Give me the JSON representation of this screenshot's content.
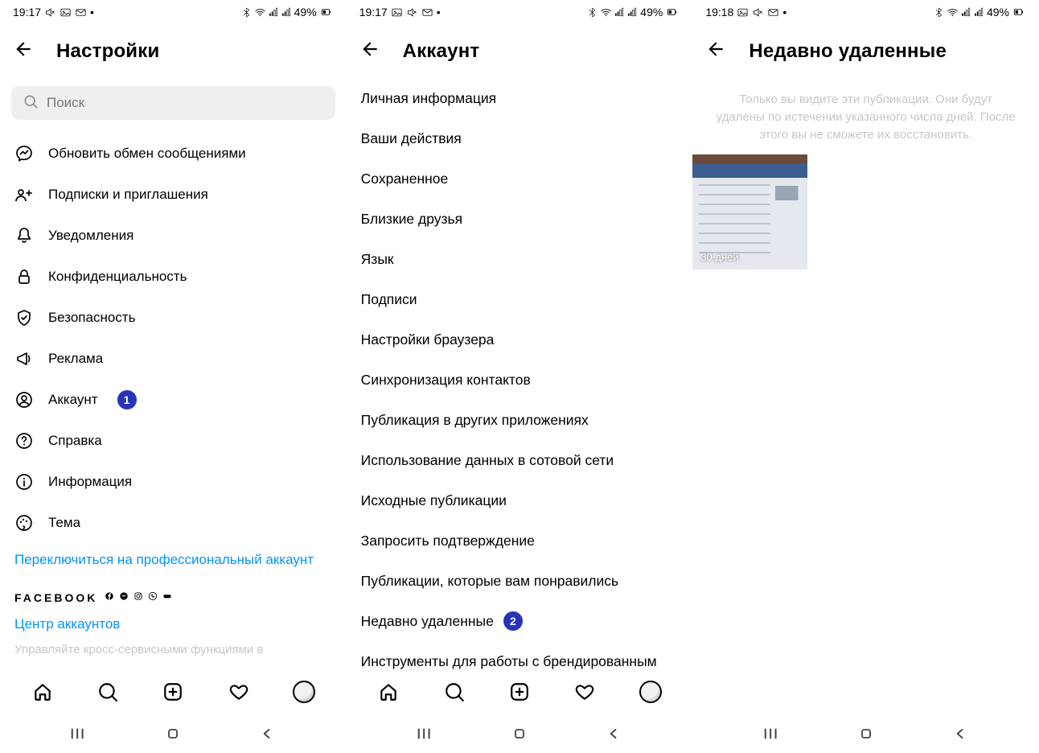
{
  "status": {
    "time1": "19:17",
    "time2": "19:17",
    "time3": "19:18",
    "battery": "49%"
  },
  "screen1": {
    "title": "Настройки",
    "search_placeholder": "Поиск",
    "items": [
      {
        "icon": "messenger",
        "label": "Обновить обмен сообщениями"
      },
      {
        "icon": "follow",
        "label": "Подписки и приглашения"
      },
      {
        "icon": "bell",
        "label": "Уведомления"
      },
      {
        "icon": "lock",
        "label": "Конфиденциальность"
      },
      {
        "icon": "shield",
        "label": "Безопасность"
      },
      {
        "icon": "megaphone",
        "label": "Реклама"
      },
      {
        "icon": "account",
        "label": "Аккаунт",
        "badge": "1"
      },
      {
        "icon": "help",
        "label": "Справка"
      },
      {
        "icon": "info",
        "label": "Информация"
      },
      {
        "icon": "palette",
        "label": "Тема"
      }
    ],
    "switch_link": "Переключиться на профессиональный аккаунт",
    "fb_label": "FACEBOOK",
    "accounts_center": "Центр аккаунтов",
    "muted_tail": "Управляйте кросс-сервисными функциями в"
  },
  "screen2": {
    "title": "Аккаунт",
    "items": [
      {
        "label": "Личная информация"
      },
      {
        "label": "Ваши действия"
      },
      {
        "label": "Сохраненное"
      },
      {
        "label": "Близкие друзья"
      },
      {
        "label": "Язык"
      },
      {
        "label": "Подписи"
      },
      {
        "label": "Настройки браузера"
      },
      {
        "label": "Синхронизация контактов"
      },
      {
        "label": "Публикация в других приложениях"
      },
      {
        "label": "Использование данных в сотовой сети"
      },
      {
        "label": "Исходные публикации"
      },
      {
        "label": "Запросить подтверждение"
      },
      {
        "label": "Публикации, которые вам понравились"
      },
      {
        "label": "Недавно удаленные",
        "badge": "2"
      },
      {
        "label": "Инструменты для работы с брендированным"
      }
    ]
  },
  "screen3": {
    "title": "Недавно удаленные",
    "info": "Только вы видите эти публикации. Они будут удалены по истечении указанного числа дней. После этого вы не сможете их восстановить.",
    "thumb_label": "30 дней"
  }
}
